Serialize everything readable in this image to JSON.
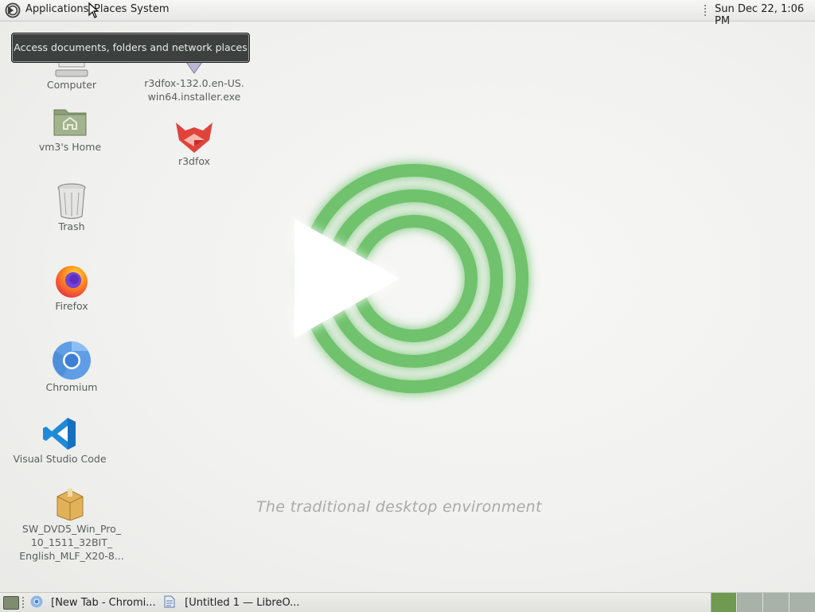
{
  "top_panel": {
    "menus": [
      "Applications",
      "Places",
      "System"
    ],
    "clock": "Sun Dec 22,  1:06 PM"
  },
  "tooltip": "Access documents, folders and network places",
  "desktop_icons": [
    {
      "label": "Computer",
      "icon": "computer-icon"
    },
    {
      "label": "vm3's Home",
      "icon": "home-folder-icon"
    },
    {
      "label": "Trash",
      "icon": "trash-icon"
    },
    {
      "label": "Firefox",
      "icon": "firefox-icon"
    },
    {
      "label": "Chromium",
      "icon": "chromium-icon"
    },
    {
      "label": "Visual Studio Code",
      "icon": "vscode-icon"
    },
    {
      "label_lines": [
        "SW_DVD5_Win_Pro_",
        "10_1511_32BIT_",
        "English_MLF_X20-8..."
      ],
      "icon": "package-icon"
    },
    {
      "label_lines": [
        "r3dfox-132.0.en-US.",
        "win64.installer.exe"
      ],
      "icon": "installer-icon"
    },
    {
      "label": "r3dfox",
      "icon": "r3dfox-icon"
    }
  ],
  "splash": {
    "tagline": "The traditional desktop environment"
  },
  "bottom_panel": {
    "tasks": [
      {
        "label": "[New Tab - Chromi...",
        "icon": "chromium-icon"
      },
      {
        "label": "[Untitled 1 — LibreO...",
        "icon": "document-icon"
      }
    ],
    "workspaces": 4,
    "active_workspace": 1
  },
  "colors": {
    "mate_green": "#6abf69",
    "tooltip_bg": "#3c403f",
    "panel_bg": "#ecece9",
    "active_workspace": "#6f9a4f"
  }
}
